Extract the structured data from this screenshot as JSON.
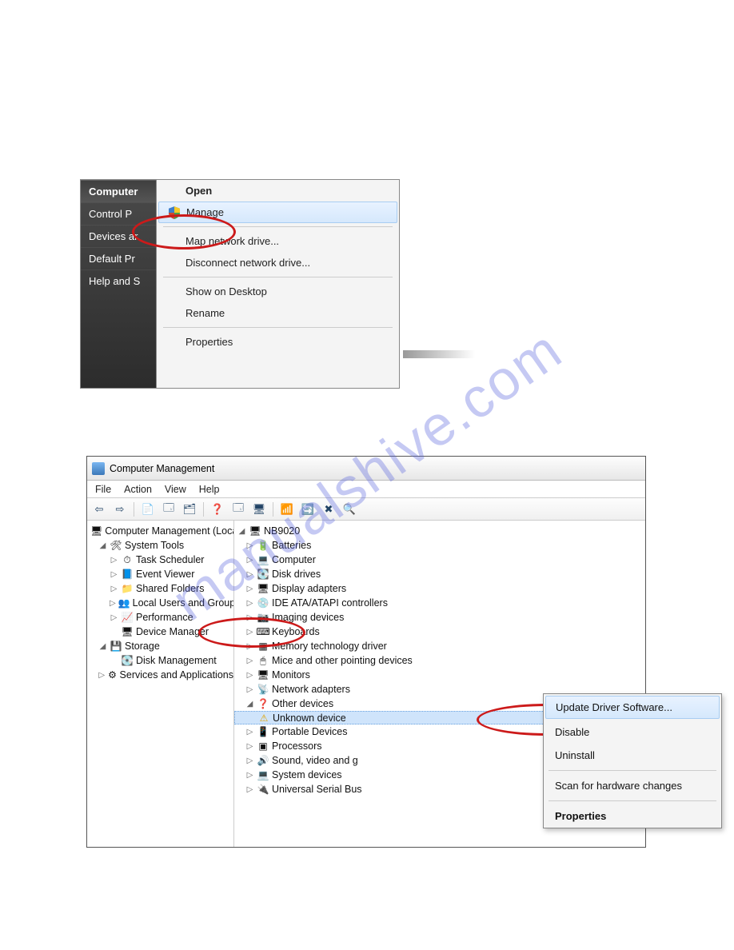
{
  "watermark": "manualshive.com",
  "shot1": {
    "start_items": [
      "Computer",
      "Control P",
      "Devices ar",
      "Default Pr",
      "Help and S"
    ],
    "menu": {
      "open": "Open",
      "manage": "Manage",
      "map": "Map network drive...",
      "disconnect": "Disconnect network drive...",
      "show_desktop": "Show on Desktop",
      "rename": "Rename",
      "properties": "Properties"
    }
  },
  "shot2": {
    "title": "Computer Management",
    "menubar": [
      "File",
      "Action",
      "View",
      "Help"
    ],
    "toolbar_icons": [
      "⇦",
      "⇨",
      "📄",
      "🗔",
      "🗂",
      "❓",
      "🗔",
      "🖥",
      "|",
      "📶",
      "🔄",
      "✖",
      "🔍"
    ],
    "left_tree": {
      "root": "Computer Management (Local",
      "system_tools": "System Tools",
      "task_scheduler": "Task Scheduler",
      "event_viewer": "Event Viewer",
      "shared_folders": "Shared Folders",
      "local_users": "Local Users and Groups",
      "performance": "Performance",
      "device_manager": "Device Manager",
      "storage": "Storage",
      "disk_management": "Disk Management",
      "services_apps": "Services and Applications"
    },
    "right_tree": {
      "root": "NB9020",
      "items": [
        "Batteries",
        "Computer",
        "Disk drives",
        "Display adapters",
        "IDE ATA/ATAPI controllers",
        "Imaging devices",
        "Keyboards",
        "Memory technology driver",
        "Mice and other pointing devices",
        "Monitors",
        "Network adapters"
      ],
      "other_devices": "Other devices",
      "unknown_device": "Unknown device",
      "items2": [
        "Portable Devices",
        "Processors",
        "Sound, video and g",
        "System devices",
        "Universal Serial Bus"
      ]
    },
    "devmenu": {
      "update": "Update Driver Software...",
      "disable": "Disable",
      "uninstall": "Uninstall",
      "scan": "Scan for hardware changes",
      "properties": "Properties"
    }
  }
}
